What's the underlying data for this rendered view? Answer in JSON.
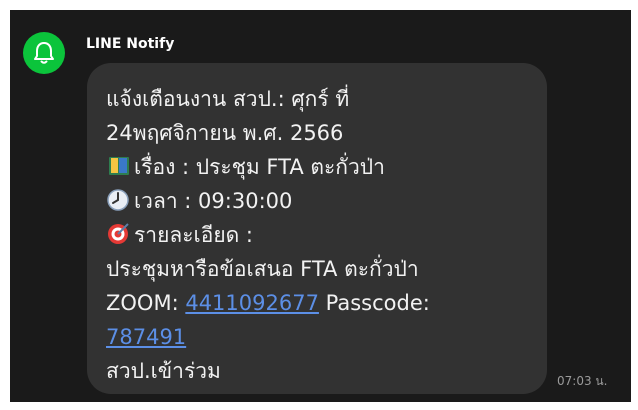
{
  "sender": {
    "name": "LINE Notify",
    "icon": "bell-icon"
  },
  "message": {
    "line1": "แจ้งเตือนงาน สวป.: ศุกร์ ที่",
    "line2": "24พฤศจิกายน พ.ศ. 2566",
    "topic": "เรื่อง : ประชุม FTA ตะกั่วป่า",
    "time_text": "เวลา : 09:30:00",
    "detail_label": "รายละเอียด :",
    "detail_text": "ประชุมหารือข้อเสนอ FTA ตะกั่วป่า",
    "zoom_label": "ZOOM:",
    "zoom_id": "4411092677",
    "passcode_label": "Passcode:",
    "passcode": "787491",
    "closing": "สวป.เข้าร่วม"
  },
  "timestamp": "07:03 น.",
  "icons": [
    "bell-icon",
    "book-icon",
    "clock-icon",
    "target-icon"
  ],
  "colors": {
    "avatar": "#0bc43b",
    "bubble": "#323232",
    "background": "#1a1a1a",
    "link": "#5c8fe6"
  }
}
